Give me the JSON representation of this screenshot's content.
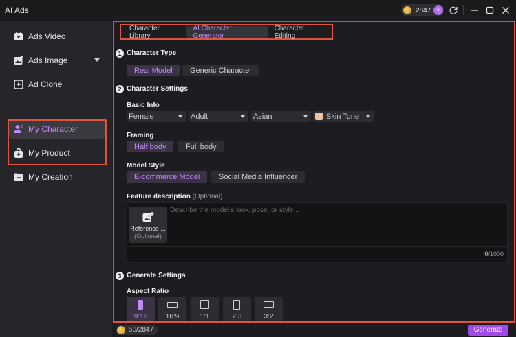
{
  "app": {
    "title": "AI Ads"
  },
  "titlebar": {
    "coins": "2847",
    "plus": "+"
  },
  "sidebar": {
    "items": [
      {
        "label": "Ads Video",
        "icon": "ads-video-icon"
      },
      {
        "label": "Ads Image",
        "icon": "ads-image-icon",
        "has_dropdown": true
      },
      {
        "label": "Ad Clone",
        "icon": "ad-clone-icon"
      },
      {
        "label": "My Character",
        "icon": "character-icon",
        "active": true
      },
      {
        "label": "My Product",
        "icon": "product-icon"
      },
      {
        "label": "My Creation",
        "icon": "folder-icon"
      }
    ]
  },
  "tabs": [
    {
      "label": "Character Library"
    },
    {
      "label": "AI Character Generator",
      "active": true
    },
    {
      "label": "Character Editing"
    }
  ],
  "sections": {
    "s1": {
      "num": "1",
      "title": "Character Type"
    },
    "s2": {
      "num": "2",
      "title": "Character Settings"
    },
    "s3": {
      "num": "3",
      "title": "Generate Settings"
    }
  },
  "character_type": {
    "options": [
      "Real Model",
      "Generic Character"
    ],
    "selected": "Real Model"
  },
  "basic_info": {
    "title": "Basic Info",
    "gender": "Female",
    "age": "Adult",
    "ethnicity": "Asian",
    "skin_tone": "Skin Tone"
  },
  "framing": {
    "title": "Framing",
    "options": [
      "Half body",
      "Full body"
    ],
    "selected": "Half body"
  },
  "model_style": {
    "title": "Model Style",
    "options": [
      "E-commerce Model",
      "Social Media Influencer"
    ],
    "selected": "E-commerce Model"
  },
  "feature": {
    "title": "Feature description",
    "optional": "(Optional)",
    "placeholder": "Describe the model’s look, pose, or style...",
    "reference_label": "Reference ...",
    "reference_optional": "(Optional)",
    "count": "0",
    "max": "/1000"
  },
  "aspect_ratio": {
    "title": "Aspect Ratio",
    "options": [
      "9:16",
      "16:9",
      "1:1",
      "2:3",
      "3:2"
    ],
    "selected": "9:16"
  },
  "footer": {
    "used": "50",
    "total": "/2847",
    "generate_label": "Generate"
  },
  "colors": {
    "accent": "#c28af7",
    "button": "#a24ae8",
    "highlight": "#e0533c",
    "background": "#1d1d21",
    "sidebar": "#26262a"
  }
}
